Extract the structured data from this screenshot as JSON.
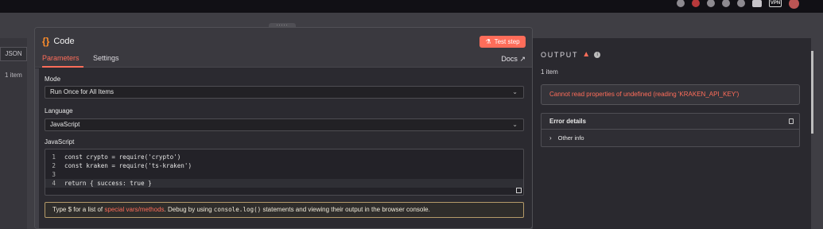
{
  "left": {
    "json_tab": "JSON",
    "item_count": "1 item"
  },
  "code_panel": {
    "handle": ":::::",
    "title": "Code",
    "test_step": "Test step",
    "tabs": {
      "parameters": "Parameters",
      "settings": "Settings"
    },
    "docs": "Docs",
    "mode": {
      "label": "Mode",
      "value": "Run Once for All Items"
    },
    "language": {
      "label": "Language",
      "value": "JavaScript"
    },
    "editor": {
      "label": "JavaScript",
      "lines": [
        {
          "number": "1",
          "text": "const crypto = require('crypto')"
        },
        {
          "number": "2",
          "text": "const kraken = require('ts-kraken')"
        },
        {
          "number": "3",
          "text": ""
        },
        {
          "number": "4",
          "text": "return { success: true }"
        }
      ]
    },
    "tip": {
      "prefix": "Type $ for a list of ",
      "link": "special vars/methods",
      "middle": ". Debug by using ",
      "mono": "console.log()",
      "suffix": " statements and viewing their output in the browser console."
    }
  },
  "output": {
    "title": "OUTPUT",
    "count": "1 item",
    "error": "Cannot read properties of undefined (reading 'KRAKEN_API_KEY')",
    "details": {
      "title": "Error details",
      "other": "Other info"
    }
  },
  "icons": [
    "braces-icon",
    "flask-icon",
    "external-link-icon",
    "chevron-down-icon",
    "warning-icon",
    "info-icon",
    "copy-icon",
    "chevron-right-icon"
  ]
}
